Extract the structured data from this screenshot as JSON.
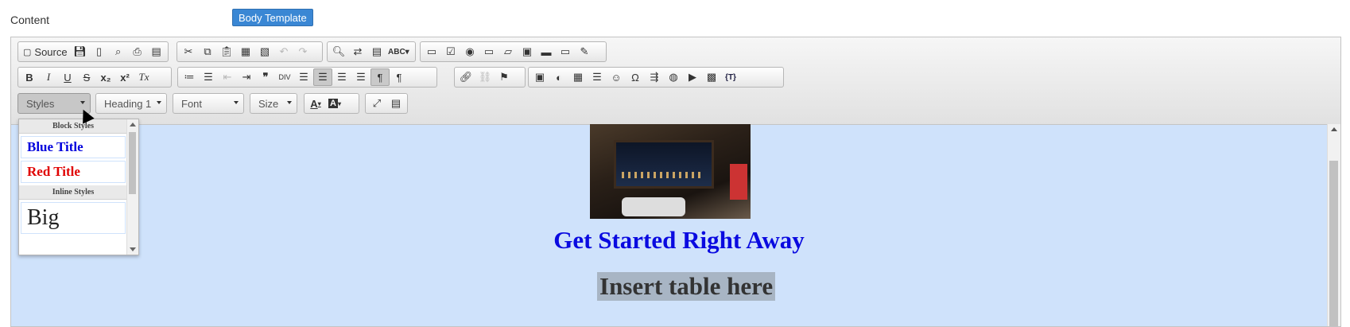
{
  "label": "Content",
  "template_button": "Body Template",
  "toolbar": {
    "source_label": "Source",
    "combos": {
      "styles": "Styles",
      "format": "Heading 1",
      "font": "Font",
      "size": "Size"
    },
    "glyphs": {
      "bold": "B",
      "italic": "I",
      "underline": "U",
      "strike": "S",
      "subscript": "x₂",
      "superscript": "x²",
      "remove_format": "Tx",
      "blockquote": "❞",
      "omega": "Ω",
      "text_color": "A",
      "bg_color": "A",
      "placeholder": "{T}"
    }
  },
  "dropdown": {
    "block_header": "Block Styles",
    "items_block": [
      {
        "label": "Blue Title",
        "color": "#0000dd"
      },
      {
        "label": "Red Title",
        "color": "#e00000"
      }
    ],
    "inline_header": "Inline Styles",
    "big": "Big"
  },
  "content": {
    "heading": "Get Started Right Away",
    "insert_table": "Insert table here"
  }
}
